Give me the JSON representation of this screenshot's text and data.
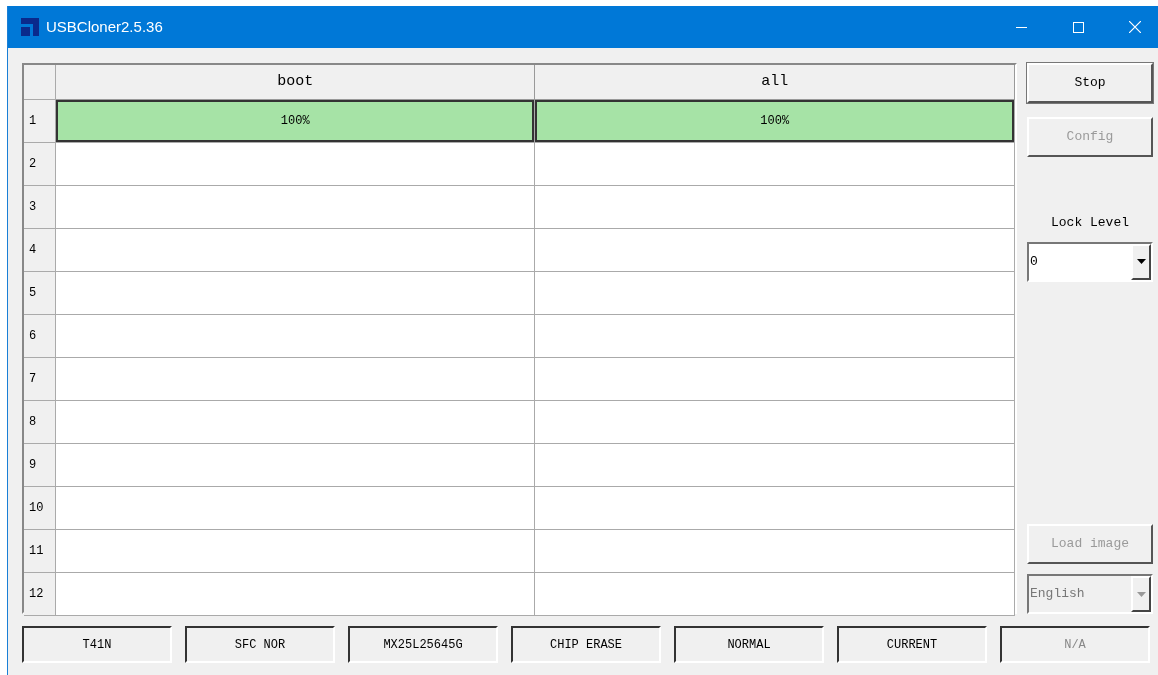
{
  "window": {
    "title": "USBCloner2.5.36"
  },
  "table": {
    "columns": [
      "boot",
      "all"
    ],
    "rows": [
      {
        "number": "1",
        "cells": [
          {
            "text": "100%",
            "level": 1
          },
          {
            "text": "100%",
            "level": 1
          }
        ]
      },
      {
        "number": "2"
      },
      {
        "number": "3"
      },
      {
        "number": "4"
      },
      {
        "number": "5"
      },
      {
        "number": "6"
      },
      {
        "number": "7"
      },
      {
        "number": "8"
      },
      {
        "number": "9"
      },
      {
        "number": "10"
      },
      {
        "number": "11"
      },
      {
        "number": "12"
      }
    ]
  },
  "side_panel": {
    "stop_button": {
      "label": "Stop",
      "disabled": false
    },
    "config_button": {
      "label": "Config",
      "disabled": true
    },
    "lock_level": {
      "label": "Lock Level",
      "value": "0",
      "disabled": false
    },
    "load_image_button": {
      "label": "Load image",
      "disabled": true
    },
    "language": {
      "value": "English",
      "disabled": true
    }
  },
  "status_bar": [
    {
      "text": "T41N",
      "disabled": false
    },
    {
      "text": "SFC NOR",
      "disabled": false
    },
    {
      "text": "MX25L25645G",
      "disabled": false
    },
    {
      "text": "CHIP ERASE",
      "disabled": false
    },
    {
      "text": "NORMAL",
      "disabled": false
    },
    {
      "text": "CURRENT",
      "disabled": false
    },
    {
      "text": "N/A",
      "disabled": true
    }
  ]
}
